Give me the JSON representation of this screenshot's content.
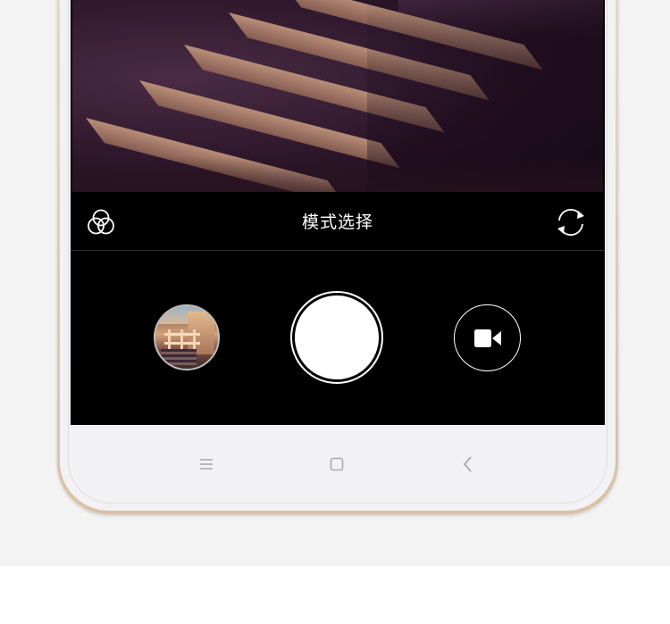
{
  "mode_bar": {
    "title": "模式选择",
    "filter_icon": "filter-circles-icon",
    "switch_icon": "switch-camera-icon"
  },
  "controls": {
    "gallery_icon": "gallery-thumbnail",
    "shutter_icon": "shutter-icon",
    "video_icon": "video-camera-icon"
  },
  "nav_bar": {
    "menu_icon": "menu-icon",
    "home_icon": "home-icon",
    "back_icon": "back-icon"
  },
  "colors": {
    "page_background": "#f3f3f3",
    "screen_background": "#000000",
    "phone_frame": "#e4d0bb",
    "phone_face": "#f2f2f4",
    "accent": "#ffffff"
  }
}
